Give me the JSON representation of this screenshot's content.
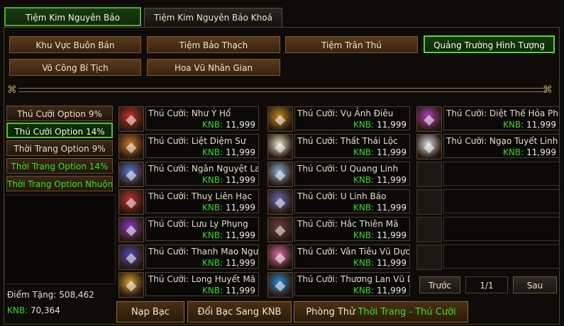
{
  "top_tabs": [
    {
      "label": "Tiệm Kim Nguyên Bảo"
    },
    {
      "label": "Tiệm Kim Nguyên Bảo Khoá"
    }
  ],
  "categories": [
    {
      "label": "Khu Vực Buôn Bán"
    },
    {
      "label": "Tiệm Bảo Thạch"
    },
    {
      "label": "Tiệm Trân Thú"
    },
    {
      "label": "Quảng Trường Hình Tượng"
    },
    {
      "label": "Võ Công Bí Tịch"
    },
    {
      "label": "Hoa Vũ Nhân Gian"
    }
  ],
  "sidebar": {
    "items": [
      {
        "label": "Thú Cưỡi Option 9%"
      },
      {
        "label": "Thú Cưỡi Option 14%"
      },
      {
        "label": "Thời Trang Option 9%"
      },
      {
        "label": "Thời Trang Option 14%"
      },
      {
        "label": "Thời Trang Option Nhuộm Màu"
      }
    ]
  },
  "stats": {
    "points_label": "Điểm Tặng:",
    "points_value": "508,462",
    "knb_label": "KNB:",
    "knb_value": "70,364"
  },
  "items": [
    {
      "name": "Thú Cưỡi: Như Ý Hổ",
      "price_label": "KNB:",
      "price": "11,999",
      "icon": "tiger-mount-icon",
      "color": "#c8302a"
    },
    {
      "name": "Thú Cưỡi: Liệt Diệm Sư",
      "price_label": "KNB:",
      "price": "11,999",
      "icon": "lion-mount-icon",
      "color": "#c77a2a"
    },
    {
      "name": "Thú Cưỡi: Ngân Nguyệt Lang",
      "price_label": "KNB:",
      "price": "11,999",
      "icon": "wolf-mount-icon",
      "color": "#5a7ad8"
    },
    {
      "name": "Thú Cưỡi: Thuỵ Liên Hạc",
      "price_label": "KNB:",
      "price": "11,999",
      "icon": "crane-mount-icon",
      "color": "#c03030"
    },
    {
      "name": "Thú Cưỡi: Lưu Ly Phụng",
      "price_label": "KNB:",
      "price": "11,999",
      "icon": "phoenix-mount-icon",
      "color": "#8a3ac8"
    },
    {
      "name": "Thú Cưỡi: Thanh Mao Ngưu",
      "price_label": "KNB:",
      "price": "11,999",
      "icon": "ox-mount-icon",
      "color": "#4a4ab8"
    },
    {
      "name": "Thú Cưỡi: Long Huyết Mã",
      "price_label": "KNB:",
      "price": "11,999",
      "icon": "horse-mount-icon",
      "color": "#d0a030"
    },
    {
      "name": "Thú Cưỡi: Vụ Ảnh Điêu",
      "price_label": "KNB:",
      "price": "11,999",
      "icon": "eagle-mount-icon",
      "color": "#c08a20"
    },
    {
      "name": "Thú Cưỡi: Thất Thái Lộc",
      "price_label": "KNB:",
      "price": "11,999",
      "icon": "deer-mount-icon",
      "color": "#e8e2c8"
    },
    {
      "name": "Thú Cưỡi: U Quang Linh",
      "price_label": "KNB:",
      "price": "11,999",
      "icon": "spirit-mount-icon",
      "color": "#8ab0d8"
    },
    {
      "name": "Thú Cưỡi: U Linh Báo",
      "price_label": "KNB:",
      "price": "11,999",
      "icon": "panther-mount-icon",
      "color": "#6a6ac0"
    },
    {
      "name": "Thú Cưỡi: Hắc Thiên Mã",
      "price_label": "KNB:",
      "price": "11,999",
      "icon": "black-horse-mount-icon",
      "color": "#6a4040"
    },
    {
      "name": "Thú Cưỡi: Vân Tiêu Vũ Dực",
      "price_label": "KNB:",
      "price": "11,999",
      "icon": "wing-mount-icon",
      "color": "#e070b0"
    },
    {
      "name": "Thú Cưỡi: Thương Lan Vũ Dực",
      "price_label": "KNB:",
      "price": "11,999",
      "icon": "blue-wing-mount-icon",
      "color": "#2a8ad8"
    },
    {
      "name": "Thú Cưỡi: Diệt Thế Hỏa Phụng",
      "price_label": "KNB:",
      "price": "11,999",
      "icon": "fire-phoenix-mount-icon",
      "color": "#b040c0"
    },
    {
      "name": "Thú Cưỡi: Ngạo Tuyết Linh Sư",
      "price_label": "KNB:",
      "price": "11,999",
      "icon": "snow-lion-mount-icon",
      "color": "#d8dce8"
    }
  ],
  "pager": {
    "prev": "Trước",
    "page": "1/1",
    "next": "Sau"
  },
  "bottom": {
    "topup": "Nạp Bạc",
    "convert": "Đổi Bạc Sang KNB",
    "fitting_prefix": "Phòng Thử ",
    "fitting_highlight": "Thời Trang - Thú Cưỡi"
  },
  "colors": {
    "accent_green": "#39d929",
    "active_border": "#4fae2d",
    "frame": "#4b4235"
  }
}
